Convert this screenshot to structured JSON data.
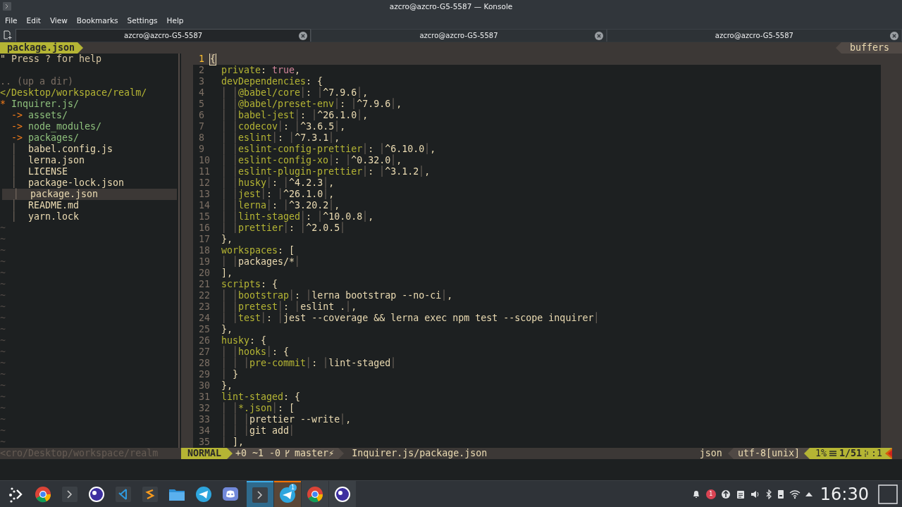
{
  "window": {
    "title": "azcro@azcro-G5-5587 — Konsole"
  },
  "menu": [
    "File",
    "Edit",
    "View",
    "Bookmarks",
    "Settings",
    "Help"
  ],
  "tabs": [
    {
      "title": "azcro@azcro-G5-5587",
      "selected": true
    },
    {
      "title": "azcro@azcro-G5-5587",
      "selected": false
    },
    {
      "title": "azcro@azcro-G5-5587",
      "selected": false
    }
  ],
  "vim": {
    "tabline": {
      "current": "package.json",
      "right": "buffers"
    },
    "tree": {
      "help": "\" Press ? for help",
      "up": ".. (up a dir)",
      "root": "</Desktop/workspace/realm/",
      "items": [
        {
          "name": "Inquirer.js/",
          "marker": "*",
          "kind": "dir",
          "selected": false,
          "children": [
            {
              "name": "assets/",
              "marker": "->",
              "kind": "dir",
              "selected": false
            },
            {
              "name": "node_modules/",
              "marker": "->",
              "kind": "dir",
              "selected": false
            },
            {
              "name": "packages/",
              "marker": "->",
              "kind": "dir",
              "selected": false
            },
            {
              "name": "babel.config.js",
              "guide": "│",
              "kind": "file",
              "selected": false
            },
            {
              "name": "lerna.json",
              "guide": "│",
              "kind": "file",
              "selected": false
            },
            {
              "name": "LICENSE",
              "guide": "│",
              "kind": "file",
              "selected": false
            },
            {
              "name": "package-lock.json",
              "guide": "│",
              "kind": "file",
              "selected": false
            },
            {
              "name": "package.json",
              "guide": "│",
              "kind": "file",
              "selected": true
            },
            {
              "name": "README.md",
              "guide": "│",
              "kind": "file",
              "selected": false
            },
            {
              "name": "yarn.lock",
              "guide": "│",
              "kind": "file",
              "selected": false
            }
          ]
        }
      ],
      "filler": [
        "~",
        "~",
        "~",
        "~",
        "~",
        "~",
        "~",
        "~",
        "~",
        "~",
        "~",
        "~",
        "~",
        "~",
        "~",
        "~",
        "~",
        "~",
        "~",
        "~"
      ],
      "status": "<cro/Desktop/workspace/realm"
    },
    "editor": {
      "lines": [
        {
          "n": "1",
          "current": true,
          "t": [
            {
              "kind": "cursor",
              "text": "{"
            }
          ]
        },
        {
          "n": "2",
          "current": false,
          "t": [
            {
              "kind": "key",
              "text": "  private"
            },
            {
              "kind": "punct",
              "text": ": "
            },
            {
              "kind": "bool",
              "text": "true"
            },
            {
              "kind": "punct",
              "text": ","
            }
          ]
        },
        {
          "n": "3",
          "current": false,
          "t": [
            {
              "kind": "key",
              "text": "  devDependencies"
            },
            {
              "kind": "punct",
              "text": ": {"
            }
          ]
        },
        {
          "n": "4",
          "current": false,
          "t": [
            {
              "kind": "guide",
              "text": "  │ │"
            },
            {
              "kind": "key",
              "text": "@babel/core"
            },
            {
              "kind": "guide",
              "text": "│"
            },
            {
              "kind": "punct",
              "text": ": "
            },
            {
              "kind": "guide",
              "text": "│"
            },
            {
              "kind": "value",
              "text": "^7.9.6"
            },
            {
              "kind": "guide",
              "text": "│"
            },
            {
              "kind": "punct",
              "text": ","
            }
          ]
        },
        {
          "n": "5",
          "current": false,
          "t": [
            {
              "kind": "guide",
              "text": "  │ │"
            },
            {
              "kind": "key",
              "text": "@babel/preset-env"
            },
            {
              "kind": "guide",
              "text": "│"
            },
            {
              "kind": "punct",
              "text": ": "
            },
            {
              "kind": "guide",
              "text": "│"
            },
            {
              "kind": "value",
              "text": "^7.9.6"
            },
            {
              "kind": "guide",
              "text": "│"
            },
            {
              "kind": "punct",
              "text": ","
            }
          ]
        },
        {
          "n": "6",
          "current": false,
          "t": [
            {
              "kind": "guide",
              "text": "  │ │"
            },
            {
              "kind": "key",
              "text": "babel-jest"
            },
            {
              "kind": "guide",
              "text": "│"
            },
            {
              "kind": "punct",
              "text": ": "
            },
            {
              "kind": "guide",
              "text": "│"
            },
            {
              "kind": "value",
              "text": "^26.1.0"
            },
            {
              "kind": "guide",
              "text": "│"
            },
            {
              "kind": "punct",
              "text": ","
            }
          ]
        },
        {
          "n": "7",
          "current": false,
          "t": [
            {
              "kind": "guide",
              "text": "  │ │"
            },
            {
              "kind": "key",
              "text": "codecov"
            },
            {
              "kind": "guide",
              "text": "│"
            },
            {
              "kind": "punct",
              "text": ": "
            },
            {
              "kind": "guide",
              "text": "│"
            },
            {
              "kind": "value",
              "text": "^3.6.5"
            },
            {
              "kind": "guide",
              "text": "│"
            },
            {
              "kind": "punct",
              "text": ","
            }
          ]
        },
        {
          "n": "8",
          "current": false,
          "t": [
            {
              "kind": "guide",
              "text": "  │ │"
            },
            {
              "kind": "key",
              "text": "eslint"
            },
            {
              "kind": "guide",
              "text": "│"
            },
            {
              "kind": "punct",
              "text": ": "
            },
            {
              "kind": "guide",
              "text": "│"
            },
            {
              "kind": "value",
              "text": "^7.3.1"
            },
            {
              "kind": "guide",
              "text": "│"
            },
            {
              "kind": "punct",
              "text": ","
            }
          ]
        },
        {
          "n": "9",
          "current": false,
          "t": [
            {
              "kind": "guide",
              "text": "  │ │"
            },
            {
              "kind": "key",
              "text": "eslint-config-prettier"
            },
            {
              "kind": "guide",
              "text": "│"
            },
            {
              "kind": "punct",
              "text": ": "
            },
            {
              "kind": "guide",
              "text": "│"
            },
            {
              "kind": "value",
              "text": "^6.10.0"
            },
            {
              "kind": "guide",
              "text": "│"
            },
            {
              "kind": "punct",
              "text": ","
            }
          ]
        },
        {
          "n": "10",
          "current": false,
          "t": [
            {
              "kind": "guide",
              "text": "  │ │"
            },
            {
              "kind": "key",
              "text": "eslint-config-xo"
            },
            {
              "kind": "guide",
              "text": "│"
            },
            {
              "kind": "punct",
              "text": ": "
            },
            {
              "kind": "guide",
              "text": "│"
            },
            {
              "kind": "value",
              "text": "^0.32.0"
            },
            {
              "kind": "guide",
              "text": "│"
            },
            {
              "kind": "punct",
              "text": ","
            }
          ]
        },
        {
          "n": "11",
          "current": false,
          "t": [
            {
              "kind": "guide",
              "text": "  │ │"
            },
            {
              "kind": "key",
              "text": "eslint-plugin-prettier"
            },
            {
              "kind": "guide",
              "text": "│"
            },
            {
              "kind": "punct",
              "text": ": "
            },
            {
              "kind": "guide",
              "text": "│"
            },
            {
              "kind": "value",
              "text": "^3.1.2"
            },
            {
              "kind": "guide",
              "text": "│"
            },
            {
              "kind": "punct",
              "text": ","
            }
          ]
        },
        {
          "n": "12",
          "current": false,
          "t": [
            {
              "kind": "guide",
              "text": "  │ │"
            },
            {
              "kind": "key",
              "text": "husky"
            },
            {
              "kind": "guide",
              "text": "│"
            },
            {
              "kind": "punct",
              "text": ": "
            },
            {
              "kind": "guide",
              "text": "│"
            },
            {
              "kind": "value",
              "text": "^4.2.3"
            },
            {
              "kind": "guide",
              "text": "│"
            },
            {
              "kind": "punct",
              "text": ","
            }
          ]
        },
        {
          "n": "13",
          "current": false,
          "t": [
            {
              "kind": "guide",
              "text": "  │ │"
            },
            {
              "kind": "key",
              "text": "jest"
            },
            {
              "kind": "guide",
              "text": "│"
            },
            {
              "kind": "punct",
              "text": ": "
            },
            {
              "kind": "guide",
              "text": "│"
            },
            {
              "kind": "value",
              "text": "^26.1.0"
            },
            {
              "kind": "guide",
              "text": "│"
            },
            {
              "kind": "punct",
              "text": ","
            }
          ]
        },
        {
          "n": "14",
          "current": false,
          "t": [
            {
              "kind": "guide",
              "text": "  │ │"
            },
            {
              "kind": "key",
              "text": "lerna"
            },
            {
              "kind": "guide",
              "text": "│"
            },
            {
              "kind": "punct",
              "text": ": "
            },
            {
              "kind": "guide",
              "text": "│"
            },
            {
              "kind": "value",
              "text": "^3.20.2"
            },
            {
              "kind": "guide",
              "text": "│"
            },
            {
              "kind": "punct",
              "text": ","
            }
          ]
        },
        {
          "n": "15",
          "current": false,
          "t": [
            {
              "kind": "guide",
              "text": "  │ │"
            },
            {
              "kind": "key",
              "text": "lint-staged"
            },
            {
              "kind": "guide",
              "text": "│"
            },
            {
              "kind": "punct",
              "text": ": "
            },
            {
              "kind": "guide",
              "text": "│"
            },
            {
              "kind": "value",
              "text": "^10.0.8"
            },
            {
              "kind": "guide",
              "text": "│"
            },
            {
              "kind": "punct",
              "text": ","
            }
          ]
        },
        {
          "n": "16",
          "current": false,
          "t": [
            {
              "kind": "guide",
              "text": "  │ │"
            },
            {
              "kind": "key",
              "text": "prettier"
            },
            {
              "kind": "guide",
              "text": "│"
            },
            {
              "kind": "punct",
              "text": ": "
            },
            {
              "kind": "guide",
              "text": "│"
            },
            {
              "kind": "value",
              "text": "^2.0.5"
            },
            {
              "kind": "guide",
              "text": "│"
            }
          ]
        },
        {
          "n": "17",
          "current": false,
          "t": [
            {
              "kind": "punct",
              "text": "  },"
            }
          ]
        },
        {
          "n": "18",
          "current": false,
          "t": [
            {
              "kind": "key",
              "text": "  workspaces"
            },
            {
              "kind": "punct",
              "text": ": ["
            }
          ]
        },
        {
          "n": "19",
          "current": false,
          "t": [
            {
              "kind": "guide",
              "text": "  │ │"
            },
            {
              "kind": "value",
              "text": "packages/*"
            },
            {
              "kind": "guide",
              "text": "│"
            }
          ]
        },
        {
          "n": "20",
          "current": false,
          "t": [
            {
              "kind": "punct",
              "text": "  ],"
            }
          ]
        },
        {
          "n": "21",
          "current": false,
          "t": [
            {
              "kind": "key",
              "text": "  scripts"
            },
            {
              "kind": "punct",
              "text": ": {"
            }
          ]
        },
        {
          "n": "22",
          "current": false,
          "t": [
            {
              "kind": "guide",
              "text": "  │ │"
            },
            {
              "kind": "key",
              "text": "bootstrap"
            },
            {
              "kind": "guide",
              "text": "│"
            },
            {
              "kind": "punct",
              "text": ": "
            },
            {
              "kind": "guide",
              "text": "│"
            },
            {
              "kind": "value",
              "text": "lerna bootstrap --no-ci"
            },
            {
              "kind": "guide",
              "text": "│"
            },
            {
              "kind": "punct",
              "text": ","
            }
          ]
        },
        {
          "n": "23",
          "current": false,
          "t": [
            {
              "kind": "guide",
              "text": "  │ │"
            },
            {
              "kind": "key",
              "text": "pretest"
            },
            {
              "kind": "guide",
              "text": "│"
            },
            {
              "kind": "punct",
              "text": ": "
            },
            {
              "kind": "guide",
              "text": "│"
            },
            {
              "kind": "value",
              "text": "eslint ."
            },
            {
              "kind": "guide",
              "text": "│"
            },
            {
              "kind": "punct",
              "text": ","
            }
          ]
        },
        {
          "n": "24",
          "current": false,
          "t": [
            {
              "kind": "guide",
              "text": "  │ │"
            },
            {
              "kind": "key",
              "text": "test"
            },
            {
              "kind": "guide",
              "text": "│"
            },
            {
              "kind": "punct",
              "text": ": "
            },
            {
              "kind": "guide",
              "text": "│"
            },
            {
              "kind": "value",
              "text": "jest --coverage && lerna exec npm test --scope inquirer"
            },
            {
              "kind": "guide",
              "text": "│"
            }
          ]
        },
        {
          "n": "25",
          "current": false,
          "t": [
            {
              "kind": "punct",
              "text": "  },"
            }
          ]
        },
        {
          "n": "26",
          "current": false,
          "t": [
            {
              "kind": "key",
              "text": "  husky"
            },
            {
              "kind": "punct",
              "text": ": {"
            }
          ]
        },
        {
          "n": "27",
          "current": false,
          "t": [
            {
              "kind": "guide",
              "text": "  │ │"
            },
            {
              "kind": "key",
              "text": "hooks"
            },
            {
              "kind": "guide",
              "text": "│"
            },
            {
              "kind": "punct",
              "text": ": {"
            }
          ]
        },
        {
          "n": "28",
          "current": false,
          "t": [
            {
              "kind": "guide",
              "text": "  │ │ │"
            },
            {
              "kind": "key",
              "text": "pre-commit"
            },
            {
              "kind": "guide",
              "text": "│"
            },
            {
              "kind": "punct",
              "text": ": "
            },
            {
              "kind": "guide",
              "text": "│"
            },
            {
              "kind": "value",
              "text": "lint-staged"
            },
            {
              "kind": "guide",
              "text": "│"
            }
          ]
        },
        {
          "n": "29",
          "current": false,
          "t": [
            {
              "kind": "guide",
              "text": "  │"
            },
            {
              "kind": "punct",
              "text": " }"
            }
          ]
        },
        {
          "n": "30",
          "current": false,
          "t": [
            {
              "kind": "punct",
              "text": "  },"
            }
          ]
        },
        {
          "n": "31",
          "current": false,
          "t": [
            {
              "kind": "key",
              "text": "  lint-staged"
            },
            {
              "kind": "punct",
              "text": ": {"
            }
          ]
        },
        {
          "n": "32",
          "current": false,
          "t": [
            {
              "kind": "guide",
              "text": "  │ │"
            },
            {
              "kind": "key",
              "text": "*.json"
            },
            {
              "kind": "guide",
              "text": "│"
            },
            {
              "kind": "punct",
              "text": ": ["
            }
          ]
        },
        {
          "n": "33",
          "current": false,
          "t": [
            {
              "kind": "guide",
              "text": "  │ │ │"
            },
            {
              "kind": "value",
              "text": "prettier --write"
            },
            {
              "kind": "guide",
              "text": "│"
            },
            {
              "kind": "punct",
              "text": ","
            }
          ]
        },
        {
          "n": "34",
          "current": false,
          "t": [
            {
              "kind": "guide",
              "text": "  │ │ │"
            },
            {
              "kind": "value",
              "text": "git add"
            },
            {
              "kind": "guide",
              "text": "│"
            }
          ]
        },
        {
          "n": "35",
          "current": false,
          "t": [
            {
              "kind": "guide",
              "text": "  │"
            },
            {
              "kind": "punct",
              "text": " ],"
            }
          ]
        }
      ]
    },
    "statusline": {
      "mode": "NORMAL",
      "hunks": "+0 ~1 -0",
      "branch": "master⚡",
      "file": "Inquirer.js/package.json",
      "filetype": "json",
      "encoding": "utf-8[unix]",
      "percent": "1%",
      "line": "1/51",
      "column": ":1"
    }
  },
  "panel": {
    "launchers": [
      {
        "kind": "launcher"
      },
      {
        "kind": "browser"
      },
      {
        "kind": "terminal"
      },
      {
        "kind": "circle"
      },
      {
        "kind": "code"
      },
      {
        "kind": "editor"
      },
      {
        "kind": "folder"
      },
      {
        "kind": "telegram"
      },
      {
        "kind": "discord"
      }
    ],
    "tasks": [
      {
        "kind": "terminal",
        "active": true,
        "attention": false
      },
      {
        "kind": "telegram",
        "active": false,
        "attention": true,
        "badge": "1"
      },
      {
        "kind": "browser",
        "active": false,
        "attention": false
      },
      {
        "kind": "circle",
        "active": false,
        "attention": false
      }
    ],
    "tray_badge": "1",
    "clock": "16:30"
  }
}
